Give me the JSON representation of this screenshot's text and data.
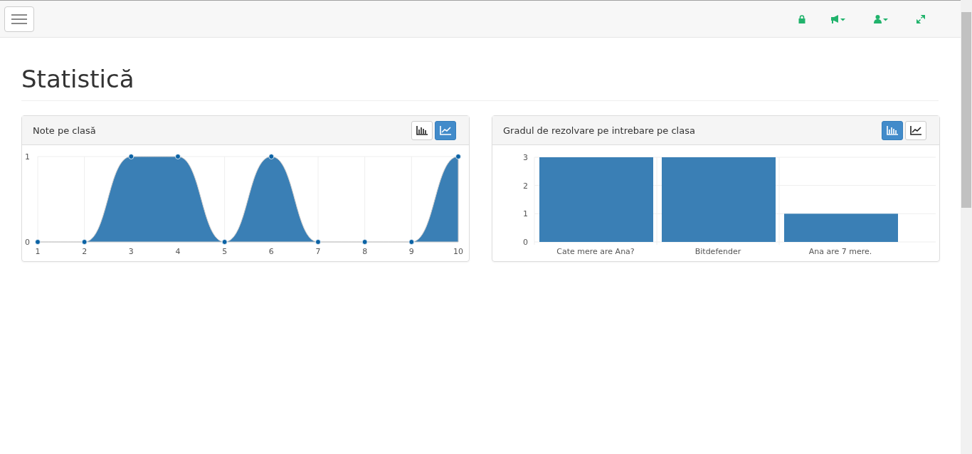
{
  "page_title": "Statistică",
  "panels": [
    {
      "title": "Note pe clasă",
      "toggles": [
        {
          "kind": "bar",
          "selected": false
        },
        {
          "kind": "line",
          "selected": true
        }
      ],
      "chart_data": {
        "type": "area",
        "categories": [
          "1",
          "2",
          "3",
          "4",
          "5",
          "6",
          "7",
          "8",
          "9",
          "10"
        ],
        "yticks": [
          0,
          1
        ],
        "ylim": [
          0,
          1
        ],
        "grid": true,
        "series": [
          {
            "color": "#3a7fb5",
            "values": [
              0,
              0,
              1,
              1,
              0,
              1,
              0,
              0,
              0,
              1
            ]
          }
        ]
      }
    },
    {
      "title": "Gradul de rezolvare pe intrebare pe clasa",
      "toggles": [
        {
          "kind": "bar",
          "selected": true
        },
        {
          "kind": "line",
          "selected": false
        }
      ],
      "chart_data": {
        "type": "bar",
        "categories": [
          "Cate mere are Ana?",
          "Bitdefender",
          "Ana are 7 mere."
        ],
        "yticks": [
          0,
          1,
          2,
          3
        ],
        "ylim": [
          0,
          3
        ],
        "grid": true,
        "series": [
          {
            "color": "#3a7fb5",
            "values": [
              3,
              3,
              1
            ]
          }
        ]
      }
    }
  ]
}
